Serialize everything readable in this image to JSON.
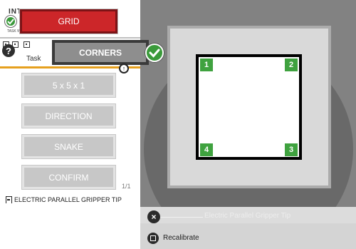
{
  "header": {
    "title": "INT",
    "subtitle": "TASK W"
  },
  "buttons": {
    "grid": "GRID",
    "corners": "CORNERS"
  },
  "task": {
    "label": "Task"
  },
  "options": [
    {
      "label": "5 x 5 x 1"
    },
    {
      "label": "DIRECTION"
    },
    {
      "label": "SNAKE"
    },
    {
      "label": "CONFIRM"
    }
  ],
  "pagination": {
    "text": "1/1"
  },
  "tool": {
    "label": "ELECTRIC PARALLEL GRIPPER TIP"
  },
  "viewport": {
    "markers": [
      "1",
      "2",
      "3",
      "4"
    ],
    "tool_overlay_label": "Electric Parallel Gripper Tip",
    "recalibrate_label": "Recalibrate"
  },
  "colors": {
    "grid_button": "#cc2629",
    "corners_button": "#8e8e8e",
    "marker_green": "#3fa23f",
    "accent_orange": "#e6a01e"
  },
  "icons": [
    "check-icon",
    "help-icon",
    "qr-code-icon",
    "up-arrow-icon",
    "close-icon",
    "gripper-icon",
    "recalibrate-icon"
  ]
}
